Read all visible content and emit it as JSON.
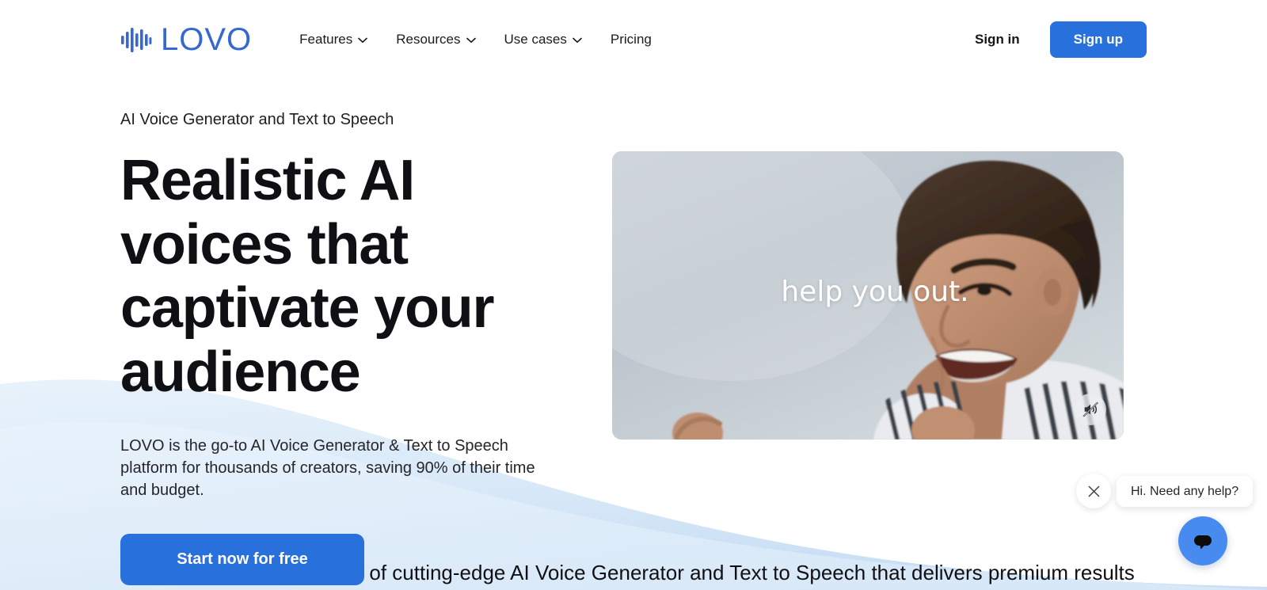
{
  "brand": {
    "name": "LOVO",
    "logo_icon": "waveform-icon",
    "color": "#3568D4"
  },
  "nav": {
    "items": [
      {
        "label": "Features",
        "has_dropdown": true,
        "icon": "chevron-down-icon"
      },
      {
        "label": "Resources",
        "has_dropdown": true,
        "icon": "chevron-down-icon"
      },
      {
        "label": "Use cases",
        "has_dropdown": true,
        "icon": "chevron-down-icon"
      },
      {
        "label": "Pricing",
        "has_dropdown": false,
        "icon": ""
      }
    ]
  },
  "header_actions": {
    "sign_in_label": "Sign in",
    "sign_up_label": "Sign up",
    "sign_up_color": "#2870DC"
  },
  "hero": {
    "eyebrow": "AI Voice Generator and Text to Speech",
    "title": "Realistic AI voices that captivate your audience",
    "subtitle": "LOVO is the go-to AI Voice Generator & Text to Speech platform for thousands of creators, saving 90% of their time and budget.",
    "cta_label": "Start now for free",
    "cta_color": "#2870DC"
  },
  "media": {
    "caption": "help you out.",
    "mute_icon": "speaker-muted-icon",
    "alt": "Smiling person in striped shirt against a light grey background"
  },
  "section": {
    "lead": "Experience the full power of cutting-edge AI Voice Generator and Text to Speech that delivers premium results"
  },
  "chat_widget": {
    "close_icon": "close-icon",
    "message": "Hi. Need any help?",
    "fab_icon": "chat-bubble-icon",
    "fab_color": "#478BF0"
  },
  "background": {
    "wave_color_top": "#E4EFFA",
    "wave_color_bottom": "#CFE3F6"
  }
}
